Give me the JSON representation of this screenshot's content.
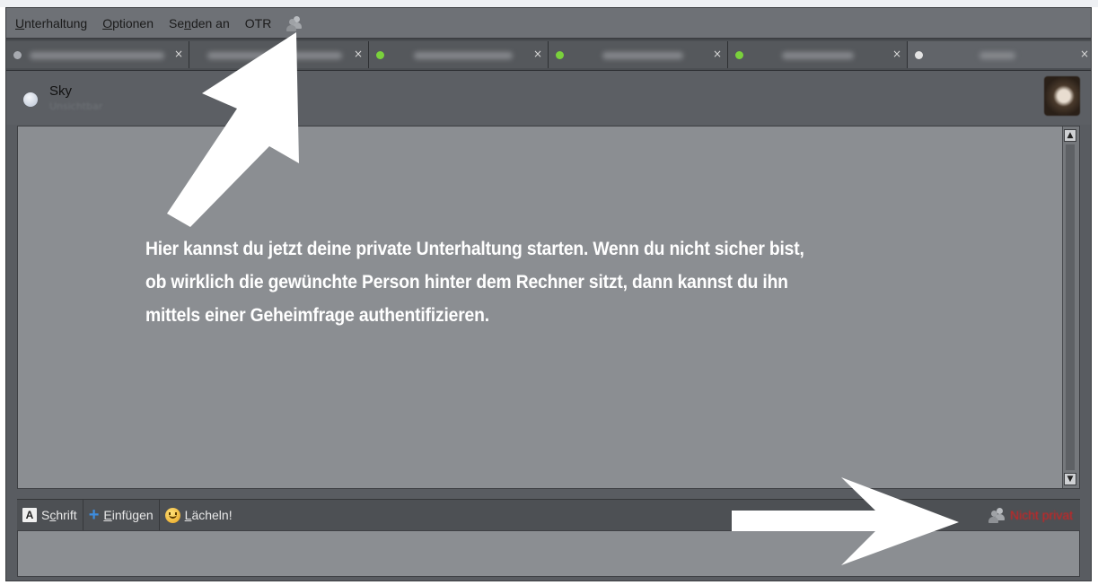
{
  "menubar": {
    "items": [
      {
        "label": "Unterhaltung",
        "underline_index": 0
      },
      {
        "label": "Optionen",
        "underline_index": 0
      },
      {
        "label": "Senden an",
        "underline_index": 2
      },
      {
        "label": "OTR",
        "underline_index": -1
      }
    ],
    "people_icon": "people-icon"
  },
  "tabs": [
    {
      "status_color": "#a7aab0",
      "close": "×"
    },
    {
      "status_color": "#a7aab0",
      "close": "×"
    },
    {
      "status_color": "#7ad13c",
      "close": "×"
    },
    {
      "status_color": "#7ad13c",
      "close": "×"
    },
    {
      "status_color": "#7ad13c",
      "close": "×"
    },
    {
      "status_color": "#e3e3e3",
      "close": "×"
    }
  ],
  "contact": {
    "name": "Sky",
    "status": "Unsichtbar"
  },
  "chat": {
    "annotation_lines": [
      "Hier kannst du jetzt deine private Unterhaltung starten. Wenn du nicht sicher bist,",
      "ob wirklich die gewünchte Person hinter dem Rechner sitzt, dann kannst du ihn",
      "mittels einer Geheimfrage authentifizieren."
    ]
  },
  "toolbar": {
    "font_label": "Schrift",
    "font_underline_index": 1,
    "insert_label": "Einfügen",
    "insert_underline_index": 0,
    "smile_label": "Lächeln!",
    "smile_underline_index": 0,
    "otr_status": "Nicht privat"
  },
  "colors": {
    "otr_status": "#d81f1f",
    "online": "#7ad13c",
    "annotation": "#ffffff"
  }
}
